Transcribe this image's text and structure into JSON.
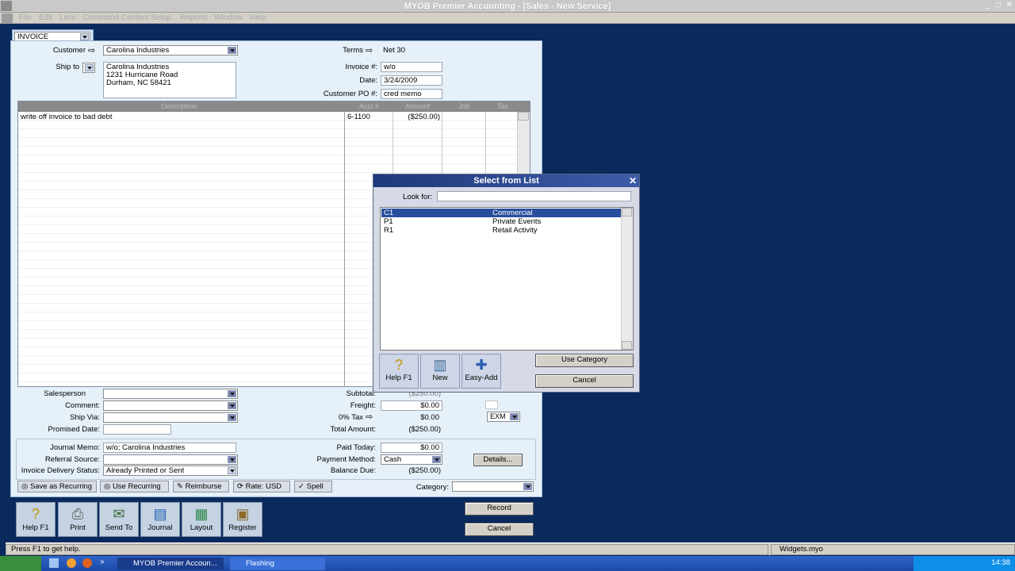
{
  "app": {
    "title": "MYOB Premier Accounting - [Sales - New Service]"
  },
  "menu": [
    "File",
    "Edit",
    "Lists",
    "Command Centers",
    "Setup",
    "Reports",
    "Window",
    "Help"
  ],
  "form": {
    "type": "INVOICE",
    "customer_label": "Customer",
    "customer": "Carolina Industries",
    "terms_label": "Terms",
    "terms": "Net 30",
    "ship_to_label": "Ship to",
    "ship_to_lines": [
      "Carolina Industries",
      "1231 Hurricane Road",
      "Durham, NC 58421"
    ],
    "invoice_no_label": "Invoice #:",
    "invoice_no": "w/o",
    "date_label": "Date:",
    "date": "3/24/2009",
    "po_label": "Customer PO #:",
    "po": "cred memo",
    "columns": [
      "Description",
      "Acct #",
      "Amount",
      "Job",
      "Tax"
    ],
    "line": {
      "description": "write off invoice to bad debt",
      "acct": "6-1100",
      "amount": "($250.00)"
    },
    "salesperson_label": "Salesperson",
    "comment_label": "Comment:",
    "ship_via_label": "Ship Via:",
    "promised_label": "Promised Date:",
    "subtotal_label": "Subtotal:",
    "subtotal": "($250.00)",
    "freight_label": "Freight:",
    "freight": "$0.00",
    "tax_label": "0% Tax",
    "tax": "$0.00",
    "tax_code": "EXM",
    "total_label": "Total Amount:",
    "total": "($250.00)",
    "journal_memo_label": "Journal Memo:",
    "journal_memo": "w/o; Carolina Industries",
    "referral_label": "Referral Source:",
    "delivery_label": "Invoice Delivery Status:",
    "delivery": "Already Printed or Sent",
    "paid_today_label": "Paid Today:",
    "paid_today": "$0.00",
    "payment_method_label": "Payment Method:",
    "payment_method": "Cash",
    "details_label": "Details...",
    "balance_due_label": "Balance Due:",
    "balance_due": "($250.00)",
    "category_label": "Category:"
  },
  "bottom_buttons": {
    "save_recurring": "Save as Recurring",
    "use_recurring": "Use Recurring",
    "reimburse": "Reimburse",
    "rate": "Rate: USD",
    "spell": "Spell"
  },
  "toolbar": [
    {
      "label": "Help F1",
      "icon": "question-icon"
    },
    {
      "label": "Print",
      "icon": "printer-icon"
    },
    {
      "label": "Send To",
      "icon": "send-icon"
    },
    {
      "label": "Journal",
      "icon": "journal-icon"
    },
    {
      "label": "Layout",
      "icon": "layout-icon"
    },
    {
      "label": "Register",
      "icon": "register-icon"
    }
  ],
  "actions": {
    "record": "Record",
    "cancel": "Cancel"
  },
  "dialog": {
    "title": "Select from List",
    "look_for_label": "Look for:",
    "items": [
      {
        "code": "C1",
        "name": "Commercial",
        "selected": true
      },
      {
        "code": "P1",
        "name": "Private Events",
        "selected": false
      },
      {
        "code": "R1",
        "name": "Retail Activity",
        "selected": false
      }
    ],
    "buttons": {
      "help": "Help F1",
      "new": "New",
      "easy_add": "Easy-Add",
      "use_category": "Use Category",
      "cancel": "Cancel"
    }
  },
  "status": {
    "left": "Press F1 to get help.",
    "right": "Widgets.myo"
  },
  "taskbar": {
    "task1": "MYOB Premier Accoun...",
    "task2": "Flashing",
    "clock": "14:38"
  }
}
